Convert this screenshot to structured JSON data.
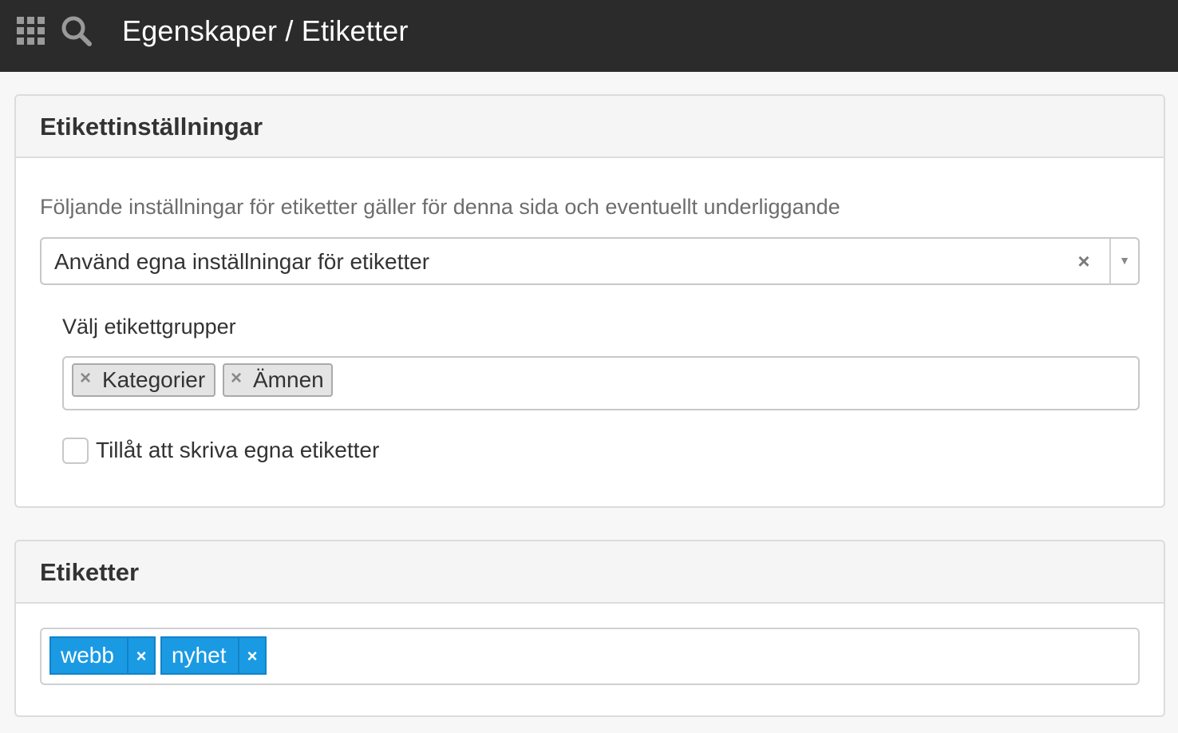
{
  "topbar": {
    "title": "Egenskaper / Etiketter",
    "icons": [
      "apps-grid-icon",
      "search-icon"
    ],
    "background": "#2b2b2b"
  },
  "settings_panel": {
    "heading": "Etikettinställningar",
    "intro": "Följande inställningar för etiketter gäller för denna sida och eventuellt underliggande",
    "mode_select": {
      "value": "Använd egna inställningar för etiketter",
      "clear_symbol": "×",
      "arrow_symbol": "▼"
    },
    "groups": {
      "label": "Välj etikettgrupper",
      "selected": [
        {
          "label": "Kategorier",
          "remove_symbol": "×"
        },
        {
          "label": "Ämnen",
          "remove_symbol": "×"
        }
      ]
    },
    "allow_custom": {
      "label": "Tillåt att skriva egna etiketter",
      "checked": false
    }
  },
  "tags_panel": {
    "heading": "Etiketter",
    "tags": [
      {
        "label": "webb",
        "remove_symbol": "×"
      },
      {
        "label": "nyhet",
        "remove_symbol": "×"
      }
    ],
    "tag_color": "#1b9ae4"
  }
}
